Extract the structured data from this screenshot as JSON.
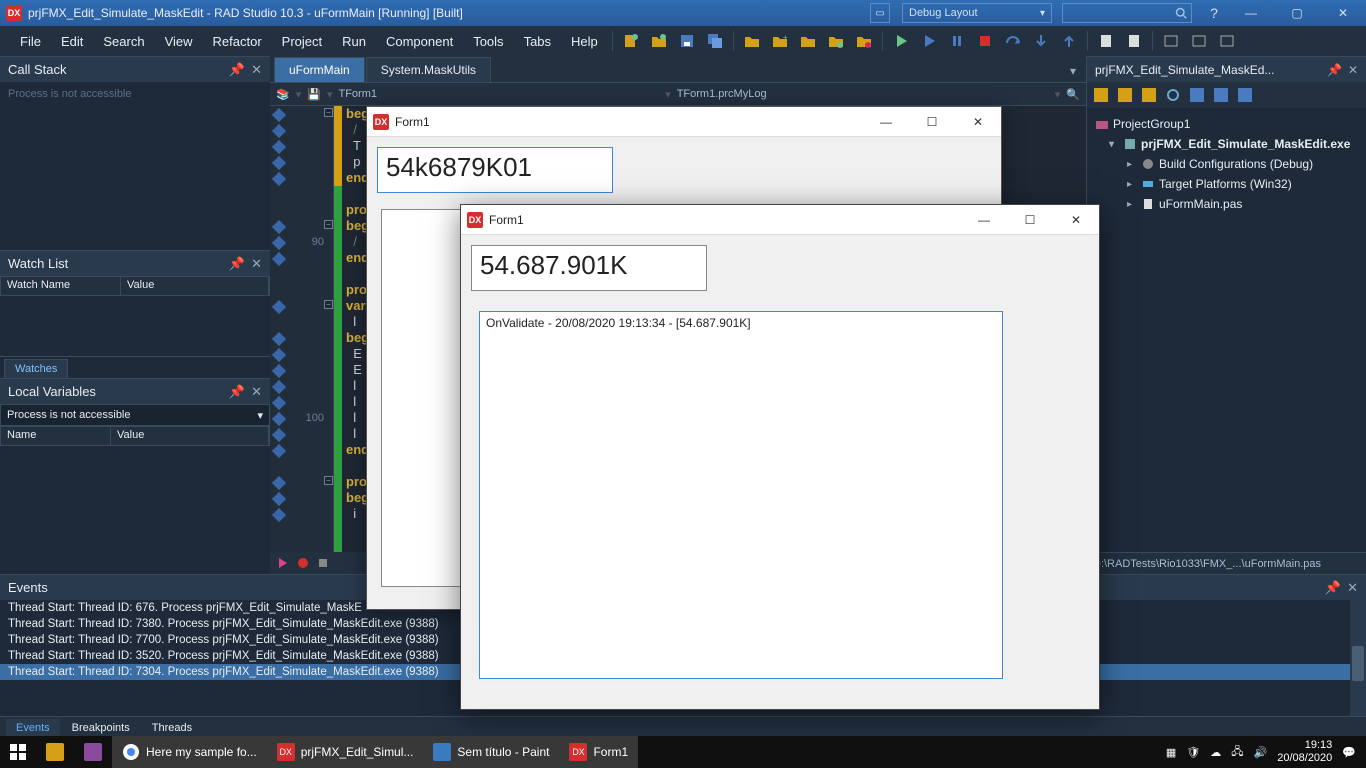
{
  "ide": {
    "title": "prjFMX_Edit_Simulate_MaskEdit - RAD Studio 10.3 - uFormMain [Running] [Built]",
    "layout": "Debug Layout"
  },
  "menu": {
    "file": "File",
    "edit": "Edit",
    "search": "Search",
    "view": "View",
    "refactor": "Refactor",
    "project": "Project",
    "run": "Run",
    "component": "Component",
    "tools": "Tools",
    "tabs": "Tabs",
    "help": "Help"
  },
  "left": {
    "callstack": {
      "title": "Call Stack",
      "msg": "Process is not accessible"
    },
    "watch": {
      "title": "Watch List",
      "col_name": "Watch Name",
      "col_value": "Value",
      "tab": "Watches"
    },
    "localvars": {
      "title": "Local Variables",
      "selector": "Process is not accessible",
      "col_name": "Name",
      "col_value": "Value"
    }
  },
  "editor": {
    "tab_main": "uFormMain",
    "tab_mask": "System.MaskUtils",
    "crumb1": "TForm1",
    "crumb2": "TForm1.prcMyLog",
    "lines": {
      "l1": "begin",
      "l2": "  /",
      "l3": "  T",
      "l4": "  p",
      "l5": "end",
      "l6": "",
      "l7": "pro",
      "l8": "begin",
      "l9": "  /",
      "l10": "end",
      "l11": "",
      "l12": "pro",
      "l13": "var",
      "l14": "  l",
      "l15": "begin",
      "l16": "  E",
      "l17": "  E",
      "l18": "  l",
      "l19": "  l",
      "l20": "  l",
      "l21": "  l",
      "l22": "end",
      "l23": "",
      "l24": "pro",
      "l25": "begin",
      "l26": "  i"
    },
    "lineno": {
      "n90": "90",
      "n100": "100"
    }
  },
  "right": {
    "title": "prjFMX_Edit_Simulate_MaskEd...",
    "group": "ProjectGroup1",
    "exe": "prjFMX_Edit_Simulate_MaskEdit.exe",
    "build": "Build Configurations (Debug)",
    "target": "Target Platforms (Win32)",
    "unit": "uFormMain.pas",
    "status": "D:\\RADTests\\Rio1033\\FMX_...\\uFormMain.pas"
  },
  "events": {
    "title": "Events",
    "rows": [
      "Thread Start: Thread ID: 676. Process prjFMX_Edit_Simulate_MaskE",
      "Thread Start: Thread ID: 7380. Process prjFMX_Edit_Simulate_MaskEdit.exe (9388)",
      "Thread Start: Thread ID: 7700. Process prjFMX_Edit_Simulate_MaskEdit.exe (9388)",
      "Thread Start: Thread ID: 3520. Process prjFMX_Edit_Simulate_MaskEdit.exe (9388)",
      "Thread Start: Thread ID: 7304. Process prjFMX_Edit_Simulate_MaskEdit.exe (9388)"
    ],
    "tab_events": "Events",
    "tab_break": "Breakpoints",
    "tab_threads": "Threads"
  },
  "form_a": {
    "title": "Form1",
    "edit_value": "54k6879K01"
  },
  "form_b": {
    "title": "Form1",
    "edit_value": "54.687.901K",
    "memo_line": "OnValidate - 20/08/2020 19:13:34 - [54.687.901K]"
  },
  "taskbar": {
    "chrome": "Here my sample fo...",
    "rad": "prjFMX_Edit_Simul...",
    "paint": "Sem título - Paint",
    "form": "Form1",
    "time": "19:13",
    "date": "20/08/2020"
  }
}
